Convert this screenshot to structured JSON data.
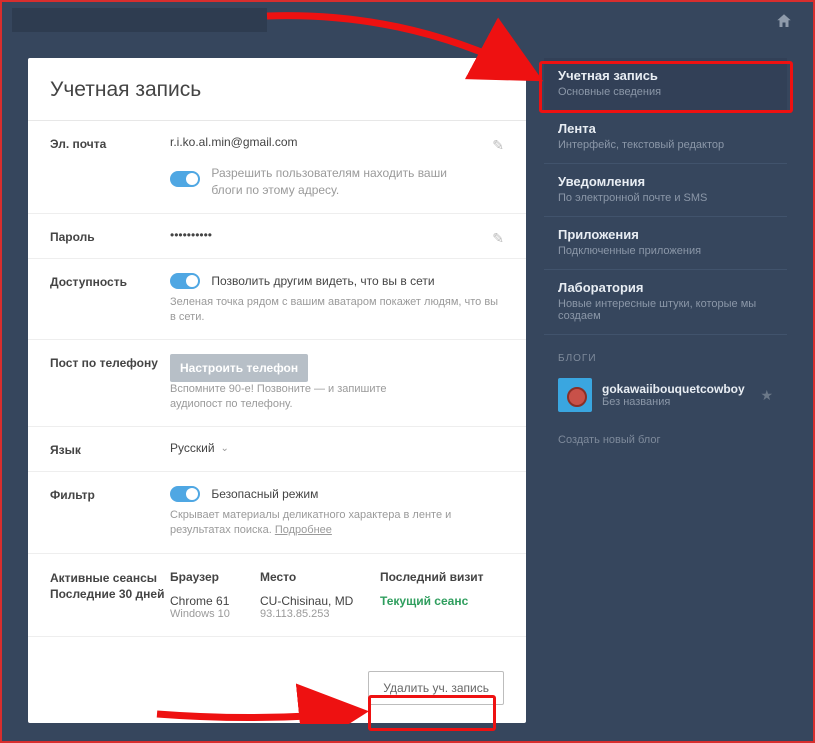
{
  "header": {
    "title": "Учетная запись"
  },
  "email": {
    "label": "Эл. почта",
    "value": "r.i.ko.al.min@gmail.com",
    "toggle_text": "Разрешить пользователям находить ваши блоги по этому адресу."
  },
  "password": {
    "label": "Пароль",
    "value": "••••••••••"
  },
  "availability": {
    "label": "Доступность",
    "toggle_text": "Позволить другим видеть, что вы в сети",
    "hint": "Зеленая точка рядом с вашим аватаром покажет людям, что вы в сети."
  },
  "phone": {
    "label": "Пост по телефону",
    "button": "Настроить телефон",
    "hint": "Вспомните 90-е! Позвоните — и запишите аудиопост по телефону."
  },
  "language": {
    "label": "Язык",
    "value": "Русский"
  },
  "filter": {
    "label": "Фильтр",
    "toggle_text": "Безопасный режим",
    "hint": "Скрывает материалы деликатного характера в ленте и результатах поиска. ",
    "more": "Подробнее"
  },
  "sessions": {
    "label": "Активные сеансы Последние 30 дней",
    "cols": {
      "browser": "Браузер",
      "location": "Место",
      "last": "Последний визит"
    },
    "row": {
      "browser": "Chrome 61",
      "os": "Windows 10",
      "location": "CU-Chisinau, MD",
      "ip": "93.113.85.253",
      "last": "Текущий сеанс"
    }
  },
  "footer": {
    "delete": "Удалить уч. запись"
  },
  "sidebar": {
    "nav": [
      {
        "title": "Учетная запись",
        "sub": "Основные сведения"
      },
      {
        "title": "Лента",
        "sub": "Интерфейс, текстовый редактор"
      },
      {
        "title": "Уведомления",
        "sub": "По электронной почте и SMS"
      },
      {
        "title": "Приложения",
        "sub": "Подключенные приложения"
      },
      {
        "title": "Лаборатория",
        "sub": "Новые интересные штуки, которые мы создаем"
      }
    ],
    "blogs_label": "БЛОГИ",
    "blog": {
      "name": "gokawaiibouquetcowboy",
      "sub": "Без названия"
    },
    "new_blog": "Создать новый блог"
  }
}
